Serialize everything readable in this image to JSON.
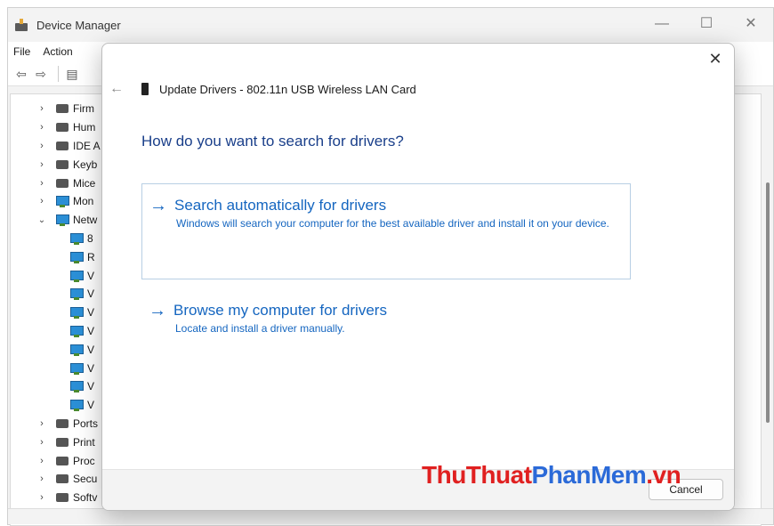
{
  "device_manager": {
    "title": "Device Manager",
    "window_controls": {
      "minimize": "—",
      "maximize": "☐",
      "close": "✕"
    },
    "menu": [
      "File",
      "Action"
    ],
    "tree_items": [
      {
        "label": "Firm",
        "expanded": false,
        "icon": "firmware-icon"
      },
      {
        "label": "Hum",
        "expanded": false,
        "icon": "hid-icon"
      },
      {
        "label": "IDE A",
        "expanded": false,
        "icon": "ide-icon"
      },
      {
        "label": "Keyb",
        "expanded": false,
        "icon": "keyboard-icon"
      },
      {
        "label": "Mice",
        "expanded": false,
        "icon": "mouse-icon"
      },
      {
        "label": "Mon",
        "expanded": false,
        "icon": "monitor-icon"
      },
      {
        "label": "Netw",
        "expanded": true,
        "icon": "network-icon"
      }
    ],
    "network_children": [
      "8",
      "R",
      "V",
      "V",
      "V",
      "V",
      "V",
      "V",
      "V",
      "V"
    ],
    "tree_items_after": [
      {
        "label": "Ports",
        "icon": "port-icon"
      },
      {
        "label": "Print",
        "icon": "printer-icon"
      },
      {
        "label": "Proc",
        "icon": "processor-icon"
      },
      {
        "label": "Secu",
        "icon": "security-icon"
      },
      {
        "label": "Softv",
        "icon": "software-icon"
      }
    ]
  },
  "dialog": {
    "close": "✕",
    "back": "←",
    "title": "Update Drivers - 802.11n USB Wireless LAN Card",
    "question": "How do you want to search for drivers?",
    "options": [
      {
        "arrow": "→",
        "title": "Search automatically for drivers",
        "description": "Windows will search your computer for the best available driver and install it on your device."
      },
      {
        "arrow": "→",
        "title": "Browse my computer for drivers",
        "description": "Locate and install a driver manually."
      }
    ],
    "cancel_label": "Cancel"
  },
  "watermark": {
    "part1": "ThuThuat",
    "part2": "PhanMem",
    "part3": ".vn"
  },
  "colors": {
    "link_blue": "#1566c0",
    "heading_blue": "#1a3f8a",
    "watermark_red": "#e02020",
    "watermark_blue": "#2b6ad8"
  }
}
